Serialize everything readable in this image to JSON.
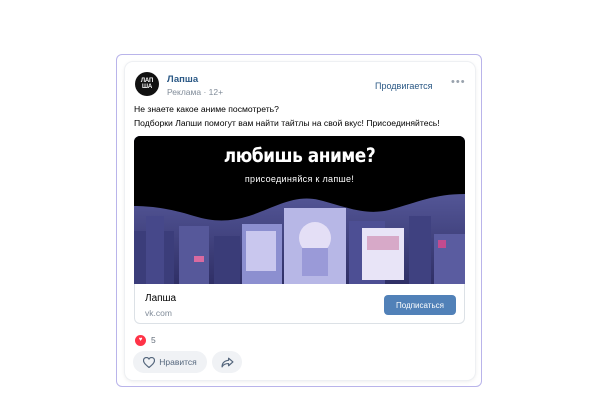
{
  "post": {
    "avatar_text": "ЛАПША",
    "brand_name": "Лапша",
    "meta": "Реклама · 12+",
    "promoted_label": "Продвигается",
    "more_label": "•••",
    "text_line1": "Не знаете какое аниме посмотреть?",
    "text_line2": "Подборки Лапши помогут вам найти тайтлы на свой вкус! Присоединяйтесь!"
  },
  "banner": {
    "headline": "любишь аниме?",
    "tagline": "присоединяйся к лапше!"
  },
  "link": {
    "title": "Лапша",
    "url": "vk.com",
    "button_label": "Подписаться"
  },
  "reactions": {
    "count": "5"
  },
  "actions": {
    "like_label": "Нравится"
  },
  "colors": {
    "link_blue": "#2a5885",
    "button_blue": "#5181b8",
    "frame_border": "#b9b4ea",
    "reaction_red": "#ff3347"
  }
}
